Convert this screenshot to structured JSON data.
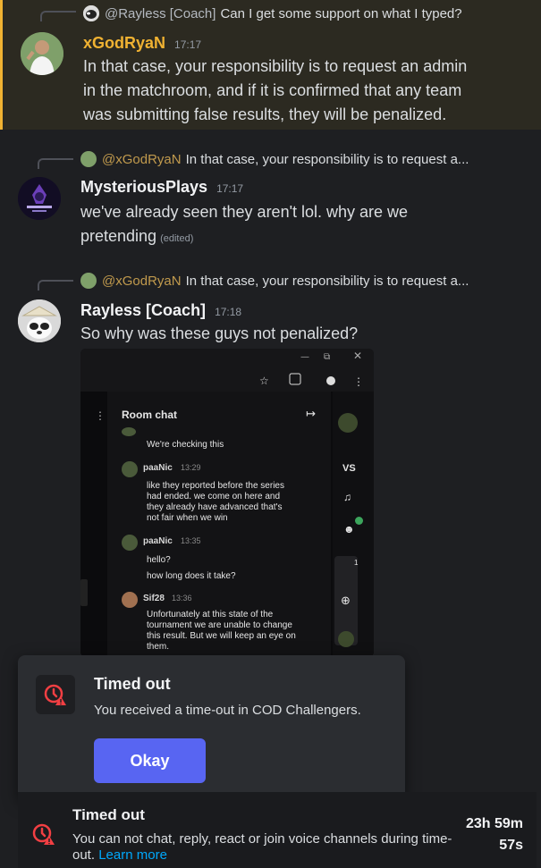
{
  "messages": [
    {
      "reply": {
        "author": "@Rayless [Coach]",
        "text": "Can I get some support on what I typed?"
      },
      "author": "xGodRyaN",
      "author_color": "#f0b232",
      "time": "17:17",
      "lines": [
        "In that case, your responsibility is to request an admin",
        "in the matchroom, and if it is confirmed that any team",
        "was submitting false results, they will be penalized."
      ]
    },
    {
      "reply": {
        "author": "@xGodRyaN",
        "text": "In that case, your responsibility is to request a..."
      },
      "author": "MysteriousPlays",
      "author_color": "#f2f3f5",
      "time": "17:17",
      "lines": [
        "we've already seen they aren't lol. why are we",
        "pretending"
      ],
      "edited": "(edited)"
    },
    {
      "reply": {
        "author": "@xGodRyaN",
        "text": "In that case, your responsibility is to request a..."
      },
      "author": "Rayless [Coach]",
      "author_color": "#f2f3f5",
      "time": "17:18",
      "lines": [
        "So why was these guys not penalized?"
      ]
    }
  ],
  "attachment": {
    "panel_title": "Room chat",
    "side_label": "VS",
    "badge": "1",
    "msg0_text": "We're checking this",
    "msg1_name": "paaNic",
    "msg1_time": "13:29",
    "msg1_lines": [
      "like they reported before the series",
      "had ended. we come on here and",
      "they already have advanced that's",
      "not fair when we win"
    ],
    "msg2_name": "paaNic",
    "msg2_time": "13:35",
    "msg2_lines": [
      "hello?",
      "how long does it take?"
    ],
    "msg3_name": "Sif28",
    "msg3_time": "13:36",
    "msg3_lines": [
      "Unfortunately at this state of the",
      "tournament we are unable to change",
      "this result. But we will keep an eye on",
      "them."
    ]
  },
  "modal": {
    "title": "Timed out",
    "body": "You received a time-out in COD Challengers.",
    "button": "Okay"
  },
  "timeout_bar": {
    "title": "Timed out",
    "body": "You can not chat, reply, react or join voice channels during time-out.",
    "link": "Learn more",
    "timer_line1": "23h 59m",
    "timer_line2": "57s"
  },
  "colors": {
    "accent": "#5865f2",
    "highlight_border": "#f0b232",
    "timeout_red": "#f23f43"
  }
}
